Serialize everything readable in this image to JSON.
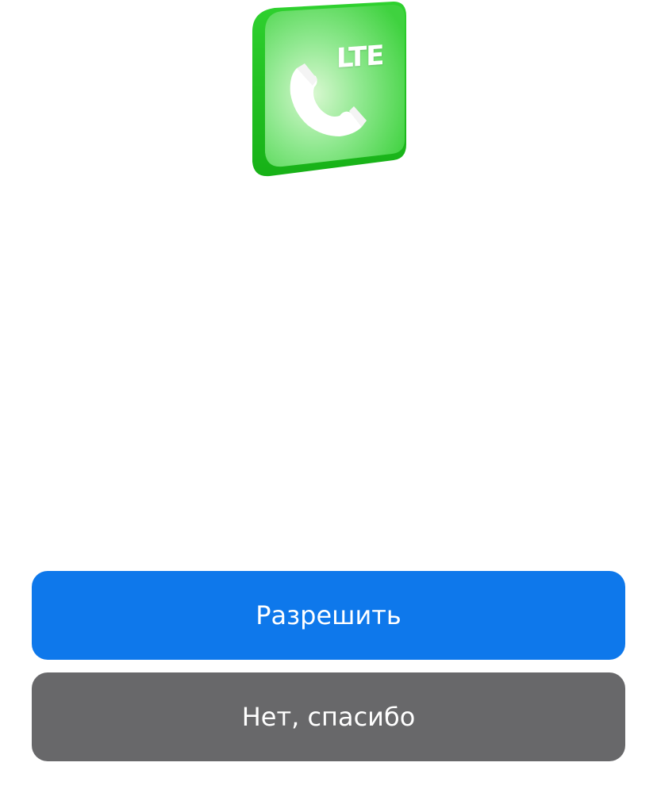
{
  "hero": {
    "icon": "lte-call-icon",
    "badge_text": "LTE",
    "colors": {
      "tile_light": "#8fe88f",
      "tile_dark": "#22c322",
      "phone": "#ffffff"
    }
  },
  "actions": {
    "allow_label": "Разрешить",
    "decline_label": "Нет, спасибо"
  },
  "colors": {
    "primary_button": "#0e78eb",
    "secondary_button": "#68686a",
    "button_text": "#ffffff",
    "background": "#ffffff"
  }
}
